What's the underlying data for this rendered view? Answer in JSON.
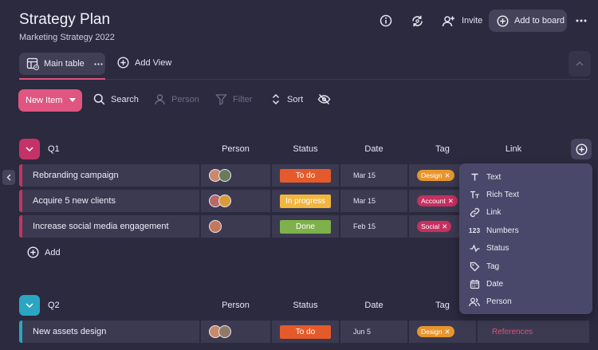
{
  "header": {
    "title": "Strategy Plan",
    "subtitle": "Marketing Strategy 2022",
    "invite_label": "Invite",
    "add_to_board_label": "Add to board"
  },
  "tabs": {
    "main_label": "Main table",
    "add_view_label": "Add View"
  },
  "toolbar": {
    "new_item_label": "New Item",
    "search_label": "Search",
    "person_label": "Person",
    "filter_label": "Filter",
    "sort_label": "Sort"
  },
  "columns": {
    "person": "Person",
    "status": "Status",
    "date": "Date",
    "tag": "Tag",
    "link": "Link"
  },
  "groups": [
    {
      "name": "Q1",
      "color": "#c43368",
      "rows": [
        {
          "name": "Rebranding campaign",
          "status": "To do",
          "status_color": "#e55a2b",
          "status_text_color": "#ffffff",
          "date": "Mar 15",
          "tag": "Design",
          "tag_color": "#e8952e"
        },
        {
          "name": "Acquire 5 new clients",
          "status": "In progress",
          "status_color": "#f3b63c",
          "status_text_color": "#ffffff",
          "date": "Mar 15",
          "tag": "Account",
          "tag_color": "#c5305f"
        },
        {
          "name": "Increase social media engagement",
          "status": "Done",
          "status_color": "#7fb14b",
          "status_text_color": "#ffffff",
          "date": "Feb 15",
          "tag": "Social",
          "tag_color": "#c5305f"
        }
      ],
      "add_label": "Add"
    },
    {
      "name": "Q2",
      "color": "#2aa6c2",
      "rows": [
        {
          "name": "New assets design",
          "status": "To do",
          "status_color": "#e55a2b",
          "status_text_color": "#ffffff",
          "date": "Jun 5",
          "tag": "Design",
          "tag_color": "#e8952e",
          "link": "References"
        }
      ]
    }
  ],
  "column_types_menu": {
    "items": [
      {
        "label": "Text",
        "icon": "text-icon"
      },
      {
        "label": "Rich Text",
        "icon": "rich-text-icon"
      },
      {
        "label": "Link",
        "icon": "link-icon"
      },
      {
        "label": "Numbers",
        "icon": "numbers-icon"
      },
      {
        "label": "Status",
        "icon": "status-icon"
      },
      {
        "label": "Tag",
        "icon": "tag-icon"
      },
      {
        "label": "Date",
        "icon": "calendar-icon"
      },
      {
        "label": "Person",
        "icon": "person-icon"
      }
    ]
  },
  "colors": {
    "background": "#2b2a3f",
    "accent": "#e05681",
    "row_bg": "#3b3a51",
    "menu_bg": "#49486a"
  }
}
